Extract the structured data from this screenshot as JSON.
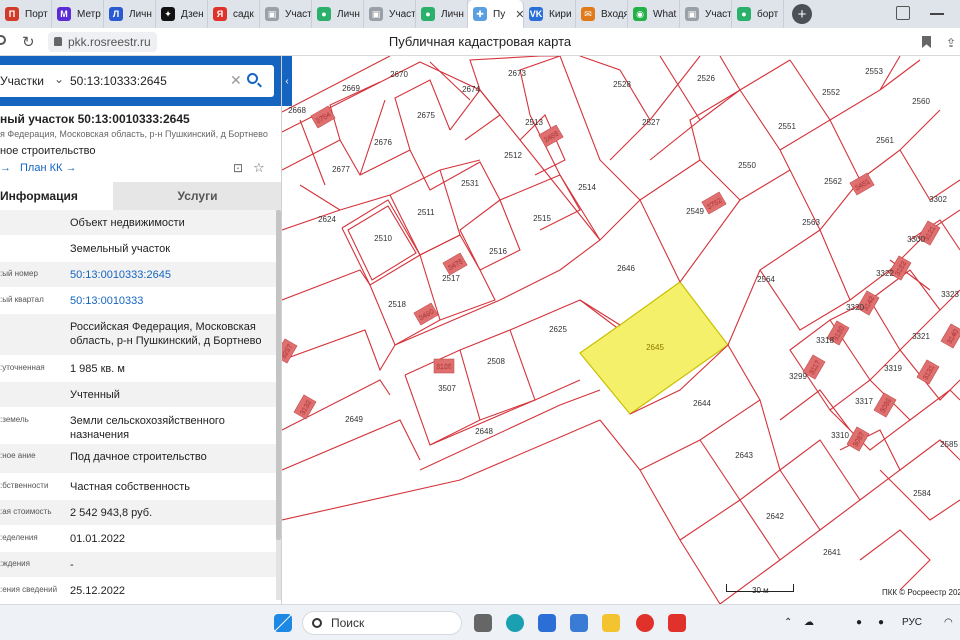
{
  "browser": {
    "tabs": [
      {
        "label": "Порт",
        "color": "#d23a2a",
        "glyph": "П"
      },
      {
        "label": "Метр",
        "color": "#5b2bd6",
        "glyph": "М"
      },
      {
        "label": "Личн",
        "color": "#2a5ad2",
        "glyph": "Л"
      },
      {
        "label": "Дзен",
        "color": "#111111",
        "glyph": "✦"
      },
      {
        "label": "садк",
        "color": "#e0322a",
        "glyph": "Я"
      },
      {
        "label": "Участ",
        "color": "#9aa0a8",
        "glyph": "▣"
      },
      {
        "label": "Личн",
        "color": "#2ab06a",
        "glyph": "●"
      },
      {
        "label": "Участ",
        "color": "#9aa0a8",
        "glyph": "▣"
      },
      {
        "label": "Личн",
        "color": "#2ab06a",
        "glyph": "●"
      },
      {
        "label": "Пу",
        "color": "#5aa0e0",
        "glyph": "✚",
        "active": true
      },
      {
        "label": "Кири",
        "color": "#2a6fd6",
        "glyph": "VK"
      },
      {
        "label": "Входя",
        "color": "#e07a1a",
        "glyph": "✉"
      },
      {
        "label": "What",
        "color": "#25b14a",
        "glyph": "◉"
      },
      {
        "label": "Участ",
        "color": "#9aa0a8",
        "glyph": "▣"
      },
      {
        "label": "борт",
        "color": "#2ab06a",
        "glyph": "●"
      }
    ],
    "url": "pkk.rosreestr.ru",
    "page_title": "Публичная кадастровая карта"
  },
  "panel": {
    "search_category": "Участки",
    "search_value": "50:13:10333:2645",
    "parcel_title": "ный участок 50:13:0010333:2645",
    "address_small": "я Федерация, Московская область, р-н Пушкинский, д Бортнево",
    "purpose_small": "ное строительство",
    "link_info": "",
    "link_plan": "План КК",
    "tab_info": "Информация",
    "tab_services": "Услуги",
    "rows": [
      {
        "key": "",
        "value": "Объект недвижимости",
        "h": 26
      },
      {
        "key": "",
        "value": "Земельный участок",
        "h": 26
      },
      {
        "key": "ый номер:",
        "value": "50:13:0010333:2645",
        "link": true,
        "h": 26
      },
      {
        "key": "ый квартал:",
        "value": "50:13:0010333",
        "link": true,
        "h": 26
      },
      {
        "key": "",
        "value": "Российская Федерация, Московская область, р-н Пушкинский, д Бортнево",
        "h": 42
      },
      {
        "key": "уточненная:",
        "value": "1 985 кв. м",
        "h": 26
      },
      {
        "key": "",
        "value": "Учтенный",
        "h": 26
      },
      {
        "key": "земель:",
        "value": "Земли сельскохозяйственного назначения",
        "h": 36
      },
      {
        "key": "ное ание:",
        "value": "Под дачное строительство",
        "h": 30
      },
      {
        "key": "бственности:",
        "value": "Частная собственность",
        "h": 26
      },
      {
        "key": "ая стоимость:",
        "value": "2 542 943,8 руб.",
        "h": 26
      },
      {
        "key": "еделения:",
        "value": "01.01.2022",
        "h": 26
      },
      {
        "key": "ждения:",
        "value": "-",
        "h": 26
      },
      {
        "key": "ения сведений:",
        "value": "25.12.2022",
        "h": 26
      }
    ]
  },
  "map": {
    "parcel_labels": [
      "2670",
      "2673",
      "2669",
      "2674",
      "2668",
      "2675",
      "2676",
      "2677",
      "2624",
      "2528",
      "2526",
      "2513",
      "2527",
      "2512",
      "2531",
      "2514",
      "2511",
      "2510",
      "2515",
      "2516",
      "2517",
      "2518",
      "2625",
      "2646",
      "2645",
      "2508",
      "3507",
      "2648",
      "2649",
      "2553",
      "2552",
      "2560",
      "2551",
      "2561",
      "2550",
      "2562",
      "2549",
      "2563",
      "2564",
      "3302",
      "3300",
      "3322",
      "3323",
      "3320",
      "3318",
      "3321",
      "3299",
      "3319",
      "3317",
      "3310",
      "2585",
      "2644",
      "2643",
      "2642",
      "2584",
      "2641"
    ],
    "building_labels": [
      "3754",
      "2456",
      "3752",
      "3451",
      "3476",
      "3490",
      "3152",
      "3142",
      "3140",
      "3117",
      "3160",
      "3089",
      "3087",
      "3121",
      "3297",
      "3132",
      "3105",
      "3131"
    ],
    "highlight_label": "2645",
    "highlight_color": "#f5f06a",
    "scale_label": "30 м",
    "copyright": "ПКК © Росреестр 2023"
  },
  "taskbar": {
    "search_label": "Поиск",
    "language": "РУС"
  }
}
